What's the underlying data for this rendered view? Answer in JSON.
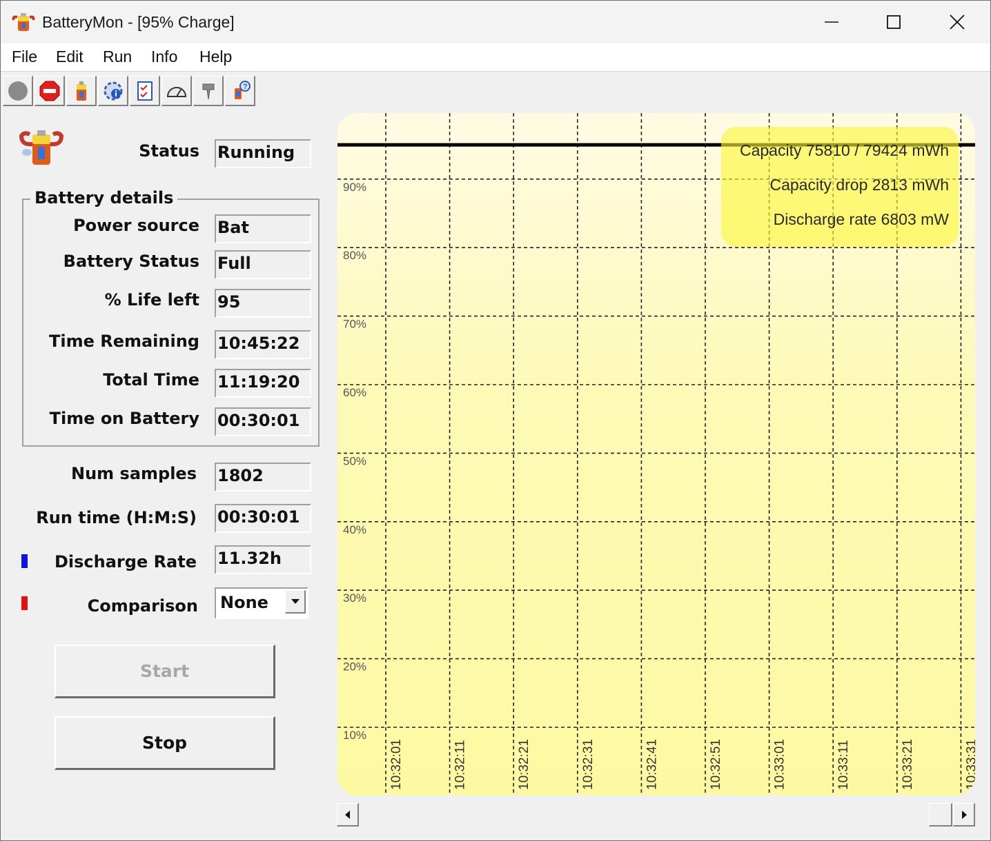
{
  "window": {
    "title": "BatteryMon - [95% Charge]"
  },
  "menu": [
    "File",
    "Edit",
    "Run",
    "Info",
    "Help"
  ],
  "toolbar": {
    "buttons": [
      "record-icon",
      "stop-sign-icon",
      "battery-icon",
      "battery-info-icon",
      "checklist-icon",
      "gauge-icon",
      "pin-icon",
      "help-icon"
    ]
  },
  "status": {
    "label": "Status",
    "value": "Running"
  },
  "battery_details": {
    "title": "Battery details",
    "power_source": {
      "label": "Power source",
      "value": "Bat"
    },
    "battery_status": {
      "label": "Battery Status",
      "value": "Full"
    },
    "life_left": {
      "label": "% Life left",
      "value": "95"
    },
    "time_remaining": {
      "label": "Time Remaining",
      "value": "10:45:22"
    },
    "total_time": {
      "label": "Total Time",
      "value": "11:19:20"
    },
    "time_on_battery": {
      "label": "Time on Battery",
      "value": "00:30:01"
    }
  },
  "stats": {
    "num_samples": {
      "label": "Num samples",
      "value": "1802"
    },
    "run_time": {
      "label": "Run time (H:M:S)",
      "value": "00:30:01"
    },
    "discharge_rate": {
      "label": "Discharge Rate",
      "value": "11.32h",
      "marker_color": "#1010e0"
    },
    "comparison": {
      "label": "Comparison",
      "value": "None",
      "marker_color": "#e01010"
    }
  },
  "buttons": {
    "start": "Start",
    "stop": "Stop"
  },
  "chart": {
    "overlay": {
      "capacity": "Capacity 75810 / 79424 mWh",
      "capacity_drop": "Capacity drop 2813 mWh",
      "discharge_rate": "Discharge rate 6803 mW"
    },
    "background": "#fdf9a2",
    "overlay_color": "#fbf63a"
  },
  "chart_data": {
    "type": "line",
    "y_ticks": [
      "90%",
      "80%",
      "70%",
      "60%",
      "50%",
      "40%",
      "30%",
      "20%",
      "10%"
    ],
    "x_ticks": [
      "10:32:01",
      "10:32:11",
      "10:32:21",
      "10:32:31",
      "10:32:41",
      "10:32:51",
      "10:33:01",
      "10:33:11",
      "10:33:21",
      "10:33:31"
    ],
    "ylim": [
      10,
      100
    ],
    "series": [
      {
        "color": "#000000",
        "values": [
          95,
          95,
          95,
          95,
          95,
          95,
          95,
          95,
          95,
          95
        ]
      }
    ],
    "grid": true
  }
}
